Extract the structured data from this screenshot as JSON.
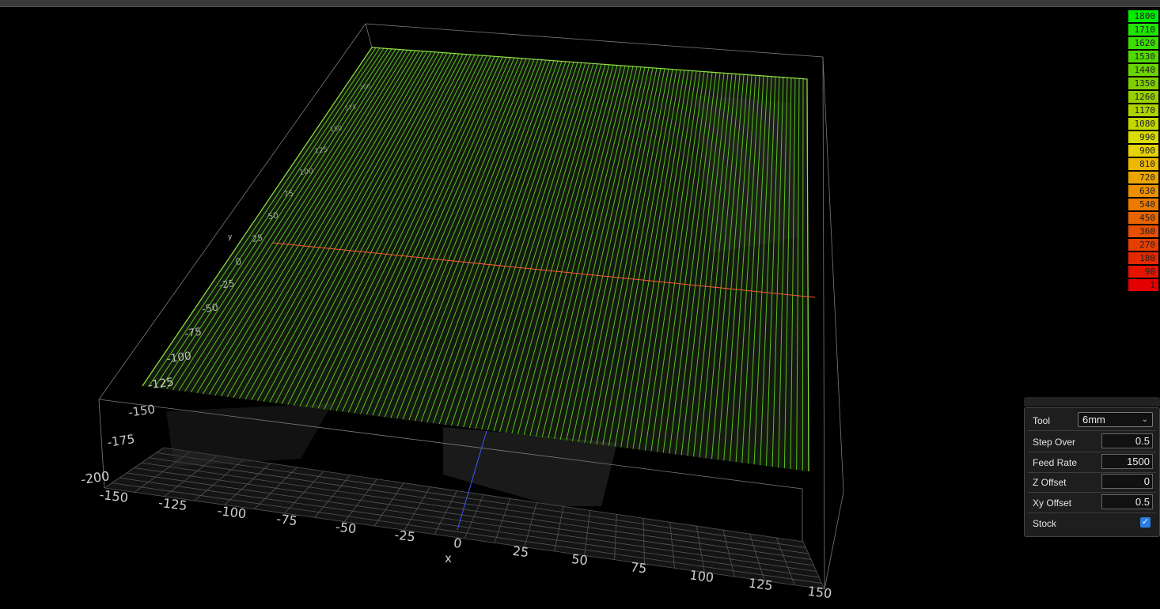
{
  "viewport": {
    "x_axis_label": "x",
    "y_axis_label": "y",
    "x_ticks": [
      "-150",
      "-125",
      "-100",
      "-75",
      "-50",
      "-25",
      "0",
      "25",
      "50",
      "75",
      "100",
      "125",
      "150"
    ],
    "y_ticks": [
      "-200",
      "-175",
      "-150",
      "-125",
      "-100",
      "-75",
      "-50",
      "-25",
      "0",
      "25",
      "50",
      "75",
      "100",
      "125",
      "150",
      "175",
      "200"
    ]
  },
  "legend": {
    "items": [
      {
        "label": "1800",
        "color": "#00ee00"
      },
      {
        "label": "1710",
        "color": "#1ee600"
      },
      {
        "label": "1620",
        "color": "#3ae000"
      },
      {
        "label": "1530",
        "color": "#52da00"
      },
      {
        "label": "1440",
        "color": "#6ad400"
      },
      {
        "label": "1350",
        "color": "#80d000"
      },
      {
        "label": "1260",
        "color": "#98d000"
      },
      {
        "label": "1170",
        "color": "#aed400"
      },
      {
        "label": "1080",
        "color": "#c4d800"
      },
      {
        "label": "990",
        "color": "#d8dc00"
      },
      {
        "label": "900",
        "color": "#e6d400"
      },
      {
        "label": "810",
        "color": "#ecb800"
      },
      {
        "label": "720",
        "color": "#eca400"
      },
      {
        "label": "630",
        "color": "#ec9000"
      },
      {
        "label": "540",
        "color": "#ea7a00"
      },
      {
        "label": "450",
        "color": "#e86400"
      },
      {
        "label": "360",
        "color": "#e65000"
      },
      {
        "label": "270",
        "color": "#e43e00"
      },
      {
        "label": "180",
        "color": "#e42800"
      },
      {
        "label": "90",
        "color": "#e41400"
      },
      {
        "label": "1",
        "color": "#e40000"
      }
    ]
  },
  "panel": {
    "tool_label": "Tool",
    "tool_value": "6mm",
    "step_over_label": "Step Over",
    "step_over_value": "0.5",
    "feed_rate_label": "Feed Rate",
    "feed_rate_value": "1500",
    "z_offset_label": "Z Offset",
    "z_offset_value": "0",
    "xy_offset_label": "Xy Offset",
    "xy_offset_value": "0.5",
    "stock_label": "Stock",
    "stock_checked": true
  },
  "colors": {
    "toolpath": "#66dd22",
    "x_axis_line": "#ff5533",
    "y_axis_line": "#4455ff",
    "grid": "#555555"
  }
}
